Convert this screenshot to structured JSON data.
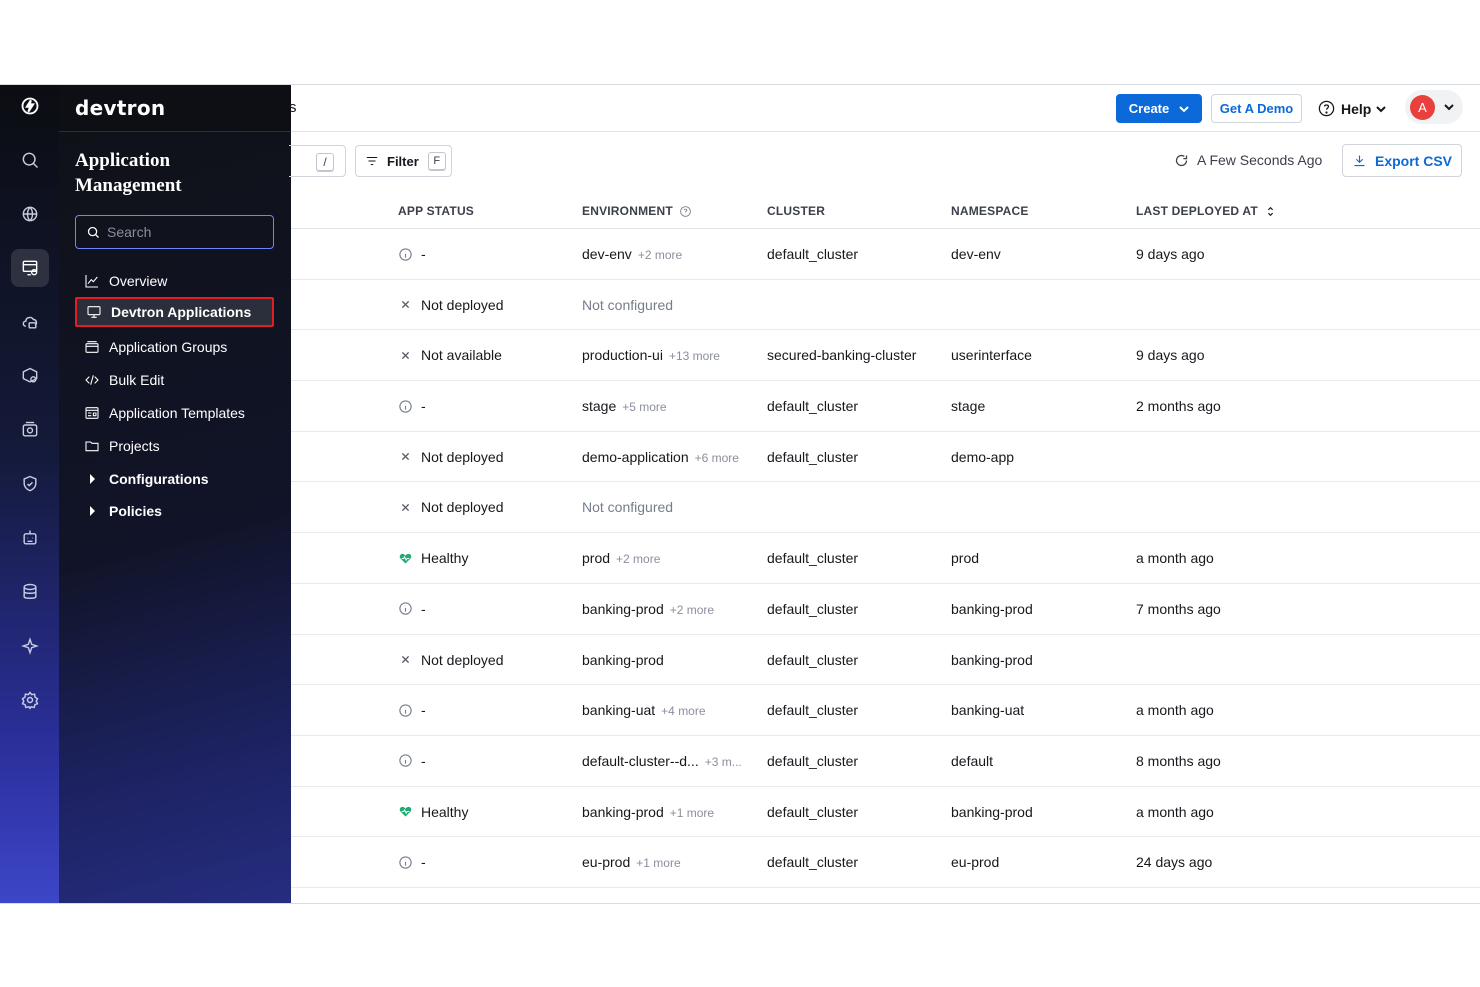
{
  "brand": "devtron",
  "nav": {
    "title": "Application Management",
    "search_placeholder": "Search",
    "items": [
      {
        "label": "Overview"
      },
      {
        "label": "Devtron Applications"
      },
      {
        "label": "Application Groups"
      },
      {
        "label": "Bulk Edit"
      },
      {
        "label": "Application Templates"
      },
      {
        "label": "Projects"
      },
      {
        "label": "Configurations"
      },
      {
        "label": "Policies"
      }
    ]
  },
  "rail_icons": [
    "devtron-logo-icon",
    "search-icon",
    "globe-icon",
    "app-management-icon",
    "infra-icon",
    "software-release-icon",
    "cost-visibility-icon",
    "security-icon",
    "automation-icon",
    "data-protection-icon",
    "ai-recommendations-icon",
    "global-config-icon"
  ],
  "header": {
    "title_fragment": "s",
    "create_label": "Create",
    "demo_label": "Get A Demo",
    "help_label": "Help",
    "avatar_initial": "A"
  },
  "toolbar": {
    "search_shortcut": "/",
    "filter_label": "Filter",
    "filter_shortcut": "F",
    "sync_text": "A Few Seconds Ago",
    "export_label": "Export CSV"
  },
  "table": {
    "columns": [
      "APP STATUS",
      "ENVIRONMENT",
      "CLUSTER",
      "NAMESPACE",
      "LAST DEPLOYED AT"
    ],
    "rows": [
      {
        "status_icon": "info",
        "status": "-",
        "env": "dev-env",
        "more": "+2 more",
        "cluster": "default_cluster",
        "namespace": "dev-env",
        "last": "9 days ago"
      },
      {
        "status_icon": "cross",
        "status": "Not deployed",
        "env": "Not configured",
        "more": "",
        "cluster": "",
        "namespace": "",
        "last": ""
      },
      {
        "status_icon": "cross",
        "status": "Not available",
        "env": "production-ui",
        "more": "+13 more",
        "cluster": "secured-banking-cluster",
        "namespace": "userinterface",
        "last": "9 days ago"
      },
      {
        "status_icon": "info",
        "status": "-",
        "env": "stage",
        "more": "+5 more",
        "cluster": "default_cluster",
        "namespace": "stage",
        "last": "2 months ago"
      },
      {
        "status_icon": "cross",
        "status": "Not deployed",
        "env": "demo-application",
        "more": "+6 more",
        "cluster": "default_cluster",
        "namespace": "demo-app",
        "last": ""
      },
      {
        "status_icon": "cross",
        "status": "Not deployed",
        "env": "Not configured",
        "more": "",
        "cluster": "",
        "namespace": "",
        "last": ""
      },
      {
        "status_icon": "heart",
        "status": "Healthy",
        "env": "prod",
        "more": "+2 more",
        "cluster": "default_cluster",
        "namespace": "prod",
        "last": "a month ago"
      },
      {
        "status_icon": "info",
        "status": "-",
        "env": "banking-prod",
        "more": "+2 more",
        "cluster": "default_cluster",
        "namespace": "banking-prod",
        "last": "7 months ago"
      },
      {
        "status_icon": "cross",
        "status": "Not deployed",
        "env": "banking-prod",
        "more": "",
        "cluster": "default_cluster",
        "namespace": "banking-prod",
        "last": ""
      },
      {
        "status_icon": "info",
        "status": "-",
        "env": "banking-uat",
        "more": "+4 more",
        "cluster": "default_cluster",
        "namespace": "banking-uat",
        "last": "a month ago"
      },
      {
        "status_icon": "info",
        "status": "-",
        "env": "default-cluster--d...",
        "more": "+3 m...",
        "cluster": "default_cluster",
        "namespace": "default",
        "last": "8 months ago"
      },
      {
        "status_icon": "heart",
        "status": "Healthy",
        "env": "banking-prod",
        "more": "+1 more",
        "cluster": "default_cluster",
        "namespace": "banking-prod",
        "last": "a month ago"
      },
      {
        "status_icon": "info",
        "status": "-",
        "env": "eu-prod",
        "more": "+1 more",
        "cluster": "default_cluster",
        "namespace": "eu-prod",
        "last": "24 days ago"
      }
    ]
  },
  "colors": {
    "accent": "#0b69d9",
    "healthy": "#1dad70",
    "selected_outline": "#e02020",
    "avatar": "#e8403e"
  }
}
